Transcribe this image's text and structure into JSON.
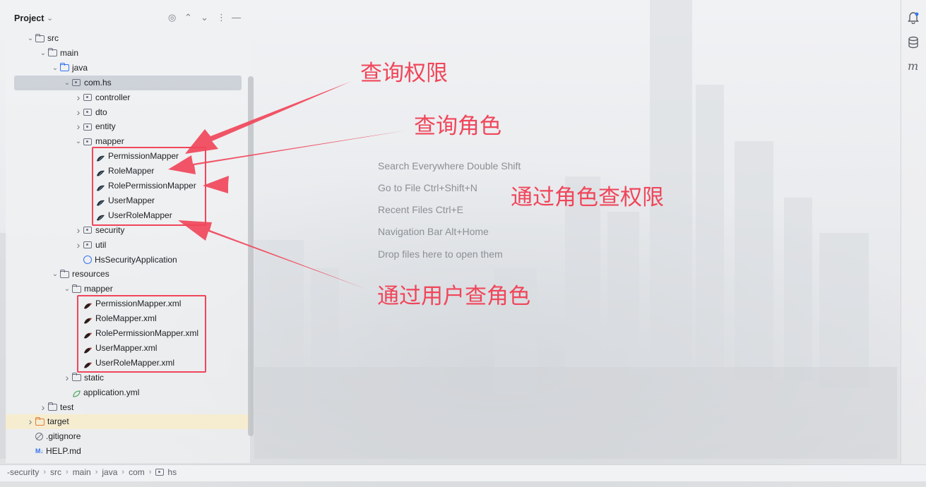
{
  "panel": {
    "title": "Project",
    "header_icons": [
      "crosshair-icon",
      "expand-icon",
      "collapse-icon",
      "more-icon",
      "minimize-icon"
    ]
  },
  "tree": [
    {
      "label": "src",
      "icon": "folder"
    },
    {
      "label": "main",
      "icon": "folder"
    },
    {
      "label": "java",
      "icon": "folder-blue"
    },
    {
      "label": "com.hs",
      "icon": "package",
      "selected": true
    },
    {
      "label": "controller",
      "icon": "package"
    },
    {
      "label": "dto",
      "icon": "package"
    },
    {
      "label": "entity",
      "icon": "package"
    },
    {
      "label": "mapper",
      "icon": "package"
    },
    {
      "label": "PermissionMapper",
      "icon": "mybatis"
    },
    {
      "label": "RoleMapper",
      "icon": "mybatis"
    },
    {
      "label": "RolePermissionMapper",
      "icon": "mybatis"
    },
    {
      "label": "UserMapper",
      "icon": "mybatis"
    },
    {
      "label": "UserRoleMapper",
      "icon": "mybatis"
    },
    {
      "label": "security",
      "icon": "package"
    },
    {
      "label": "util",
      "icon": "package"
    },
    {
      "label": "HsSecurityApplication",
      "icon": "spring-app"
    },
    {
      "label": "resources",
      "icon": "folder-resources"
    },
    {
      "label": "mapper",
      "icon": "folder"
    },
    {
      "label": "PermissionMapper.xml",
      "icon": "mybatis-xml"
    },
    {
      "label": "RoleMapper.xml",
      "icon": "mybatis-xml"
    },
    {
      "label": "RolePermissionMapper.xml",
      "icon": "mybatis-xml"
    },
    {
      "label": "UserMapper.xml",
      "icon": "mybatis-xml"
    },
    {
      "label": "UserRoleMapper.xml",
      "icon": "mybatis-xml"
    },
    {
      "label": "static",
      "icon": "folder"
    },
    {
      "label": "application.yml",
      "icon": "yaml"
    },
    {
      "label": "test",
      "icon": "folder"
    },
    {
      "label": "target",
      "icon": "folder-excluded"
    },
    {
      "label": ".gitignore",
      "icon": "ignore"
    },
    {
      "label": "HELP.md",
      "icon": "markdown"
    }
  ],
  "annotations": {
    "query_permission": "查询权限",
    "query_role": "查询角色",
    "role_to_permission": "通过角色查权限",
    "user_to_role": "通过用户查角色"
  },
  "hints": [
    "Search Everywhere Double Shift",
    "Go to File Ctrl+Shift+N",
    "Recent Files Ctrl+E",
    "Navigation Bar Alt+Home",
    "Drop files here to open them"
  ],
  "right_strip_icons": [
    "notifications-icon",
    "database-icon",
    "maven-icon"
  ],
  "maven_label": "m",
  "breadcrumb": [
    "-security",
    "src",
    "main",
    "java",
    "com",
    "hs"
  ],
  "colors": {
    "annotation": "#f0465a",
    "selected": "#c8cdd4",
    "accent": "#3574f0"
  }
}
